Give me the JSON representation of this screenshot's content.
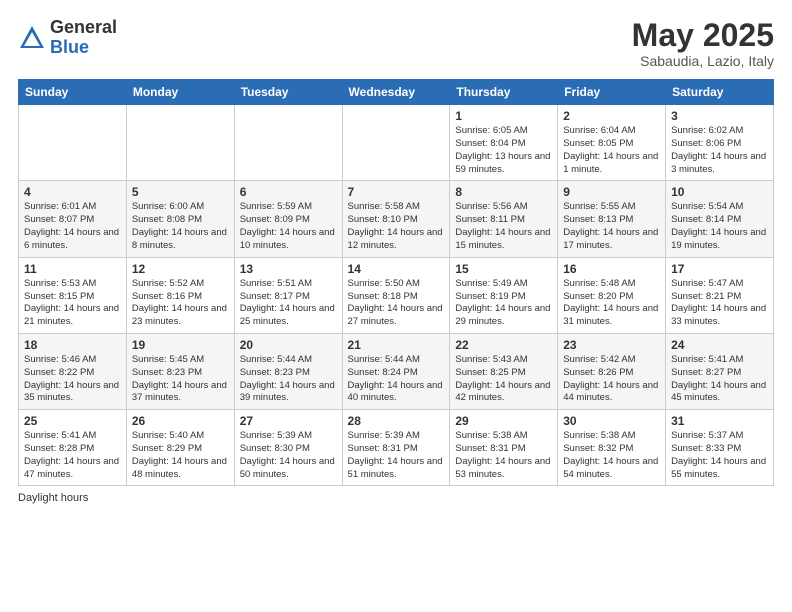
{
  "logo": {
    "general": "General",
    "blue": "Blue"
  },
  "title": "May 2025",
  "subtitle": "Sabaudia, Lazio, Italy",
  "days_of_week": [
    "Sunday",
    "Monday",
    "Tuesday",
    "Wednesday",
    "Thursday",
    "Friday",
    "Saturday"
  ],
  "footer": "Daylight hours",
  "weeks": [
    [
      {
        "day": "",
        "sunrise": "",
        "sunset": "",
        "daylight": ""
      },
      {
        "day": "",
        "sunrise": "",
        "sunset": "",
        "daylight": ""
      },
      {
        "day": "",
        "sunrise": "",
        "sunset": "",
        "daylight": ""
      },
      {
        "day": "",
        "sunrise": "",
        "sunset": "",
        "daylight": ""
      },
      {
        "day": "1",
        "sunrise": "Sunrise: 6:05 AM",
        "sunset": "Sunset: 8:04 PM",
        "daylight": "Daylight: 13 hours and 59 minutes."
      },
      {
        "day": "2",
        "sunrise": "Sunrise: 6:04 AM",
        "sunset": "Sunset: 8:05 PM",
        "daylight": "Daylight: 14 hours and 1 minute."
      },
      {
        "day": "3",
        "sunrise": "Sunrise: 6:02 AM",
        "sunset": "Sunset: 8:06 PM",
        "daylight": "Daylight: 14 hours and 3 minutes."
      }
    ],
    [
      {
        "day": "4",
        "sunrise": "Sunrise: 6:01 AM",
        "sunset": "Sunset: 8:07 PM",
        "daylight": "Daylight: 14 hours and 6 minutes."
      },
      {
        "day": "5",
        "sunrise": "Sunrise: 6:00 AM",
        "sunset": "Sunset: 8:08 PM",
        "daylight": "Daylight: 14 hours and 8 minutes."
      },
      {
        "day": "6",
        "sunrise": "Sunrise: 5:59 AM",
        "sunset": "Sunset: 8:09 PM",
        "daylight": "Daylight: 14 hours and 10 minutes."
      },
      {
        "day": "7",
        "sunrise": "Sunrise: 5:58 AM",
        "sunset": "Sunset: 8:10 PM",
        "daylight": "Daylight: 14 hours and 12 minutes."
      },
      {
        "day": "8",
        "sunrise": "Sunrise: 5:56 AM",
        "sunset": "Sunset: 8:11 PM",
        "daylight": "Daylight: 14 hours and 15 minutes."
      },
      {
        "day": "9",
        "sunrise": "Sunrise: 5:55 AM",
        "sunset": "Sunset: 8:13 PM",
        "daylight": "Daylight: 14 hours and 17 minutes."
      },
      {
        "day": "10",
        "sunrise": "Sunrise: 5:54 AM",
        "sunset": "Sunset: 8:14 PM",
        "daylight": "Daylight: 14 hours and 19 minutes."
      }
    ],
    [
      {
        "day": "11",
        "sunrise": "Sunrise: 5:53 AM",
        "sunset": "Sunset: 8:15 PM",
        "daylight": "Daylight: 14 hours and 21 minutes."
      },
      {
        "day": "12",
        "sunrise": "Sunrise: 5:52 AM",
        "sunset": "Sunset: 8:16 PM",
        "daylight": "Daylight: 14 hours and 23 minutes."
      },
      {
        "day": "13",
        "sunrise": "Sunrise: 5:51 AM",
        "sunset": "Sunset: 8:17 PM",
        "daylight": "Daylight: 14 hours and 25 minutes."
      },
      {
        "day": "14",
        "sunrise": "Sunrise: 5:50 AM",
        "sunset": "Sunset: 8:18 PM",
        "daylight": "Daylight: 14 hours and 27 minutes."
      },
      {
        "day": "15",
        "sunrise": "Sunrise: 5:49 AM",
        "sunset": "Sunset: 8:19 PM",
        "daylight": "Daylight: 14 hours and 29 minutes."
      },
      {
        "day": "16",
        "sunrise": "Sunrise: 5:48 AM",
        "sunset": "Sunset: 8:20 PM",
        "daylight": "Daylight: 14 hours and 31 minutes."
      },
      {
        "day": "17",
        "sunrise": "Sunrise: 5:47 AM",
        "sunset": "Sunset: 8:21 PM",
        "daylight": "Daylight: 14 hours and 33 minutes."
      }
    ],
    [
      {
        "day": "18",
        "sunrise": "Sunrise: 5:46 AM",
        "sunset": "Sunset: 8:22 PM",
        "daylight": "Daylight: 14 hours and 35 minutes."
      },
      {
        "day": "19",
        "sunrise": "Sunrise: 5:45 AM",
        "sunset": "Sunset: 8:23 PM",
        "daylight": "Daylight: 14 hours and 37 minutes."
      },
      {
        "day": "20",
        "sunrise": "Sunrise: 5:44 AM",
        "sunset": "Sunset: 8:23 PM",
        "daylight": "Daylight: 14 hours and 39 minutes."
      },
      {
        "day": "21",
        "sunrise": "Sunrise: 5:44 AM",
        "sunset": "Sunset: 8:24 PM",
        "daylight": "Daylight: 14 hours and 40 minutes."
      },
      {
        "day": "22",
        "sunrise": "Sunrise: 5:43 AM",
        "sunset": "Sunset: 8:25 PM",
        "daylight": "Daylight: 14 hours and 42 minutes."
      },
      {
        "day": "23",
        "sunrise": "Sunrise: 5:42 AM",
        "sunset": "Sunset: 8:26 PM",
        "daylight": "Daylight: 14 hours and 44 minutes."
      },
      {
        "day": "24",
        "sunrise": "Sunrise: 5:41 AM",
        "sunset": "Sunset: 8:27 PM",
        "daylight": "Daylight: 14 hours and 45 minutes."
      }
    ],
    [
      {
        "day": "25",
        "sunrise": "Sunrise: 5:41 AM",
        "sunset": "Sunset: 8:28 PM",
        "daylight": "Daylight: 14 hours and 47 minutes."
      },
      {
        "day": "26",
        "sunrise": "Sunrise: 5:40 AM",
        "sunset": "Sunset: 8:29 PM",
        "daylight": "Daylight: 14 hours and 48 minutes."
      },
      {
        "day": "27",
        "sunrise": "Sunrise: 5:39 AM",
        "sunset": "Sunset: 8:30 PM",
        "daylight": "Daylight: 14 hours and 50 minutes."
      },
      {
        "day": "28",
        "sunrise": "Sunrise: 5:39 AM",
        "sunset": "Sunset: 8:31 PM",
        "daylight": "Daylight: 14 hours and 51 minutes."
      },
      {
        "day": "29",
        "sunrise": "Sunrise: 5:38 AM",
        "sunset": "Sunset: 8:31 PM",
        "daylight": "Daylight: 14 hours and 53 minutes."
      },
      {
        "day": "30",
        "sunrise": "Sunrise: 5:38 AM",
        "sunset": "Sunset: 8:32 PM",
        "daylight": "Daylight: 14 hours and 54 minutes."
      },
      {
        "day": "31",
        "sunrise": "Sunrise: 5:37 AM",
        "sunset": "Sunset: 8:33 PM",
        "daylight": "Daylight: 14 hours and 55 minutes."
      }
    ]
  ]
}
